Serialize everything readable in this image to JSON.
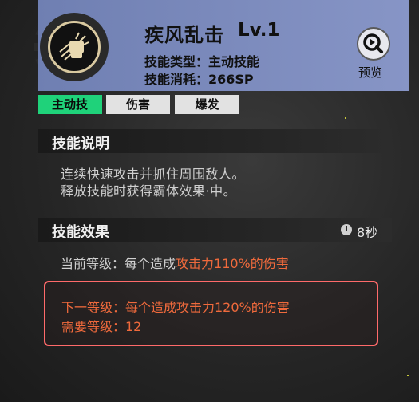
{
  "skill": {
    "name": "疾风乱击",
    "level": "Lv.1",
    "type_line": "技能类型：主动技能",
    "cost_line": "技能消耗：266SP",
    "preview_label": "预览"
  },
  "tags": [
    "主动技",
    "伤害",
    "爆发"
  ],
  "description": {
    "title": "技能说明",
    "lines": [
      "连续快速攻击并抓住周围敌人。",
      "释放技能时获得霸体效果·中。"
    ]
  },
  "effect": {
    "title": "技能效果",
    "duration": "8秒",
    "current_label": "当前等级：每个造成",
    "current_value": "攻击力110%的伤害",
    "next_line": "下一等级：每个造成攻击力120%的伤害",
    "required_line": "需要等级：12"
  },
  "colors": {
    "card": "#7f8ec0",
    "active_tag": "#1fd27a",
    "highlight": "#f06a3c",
    "border": "#ff6a6a"
  }
}
